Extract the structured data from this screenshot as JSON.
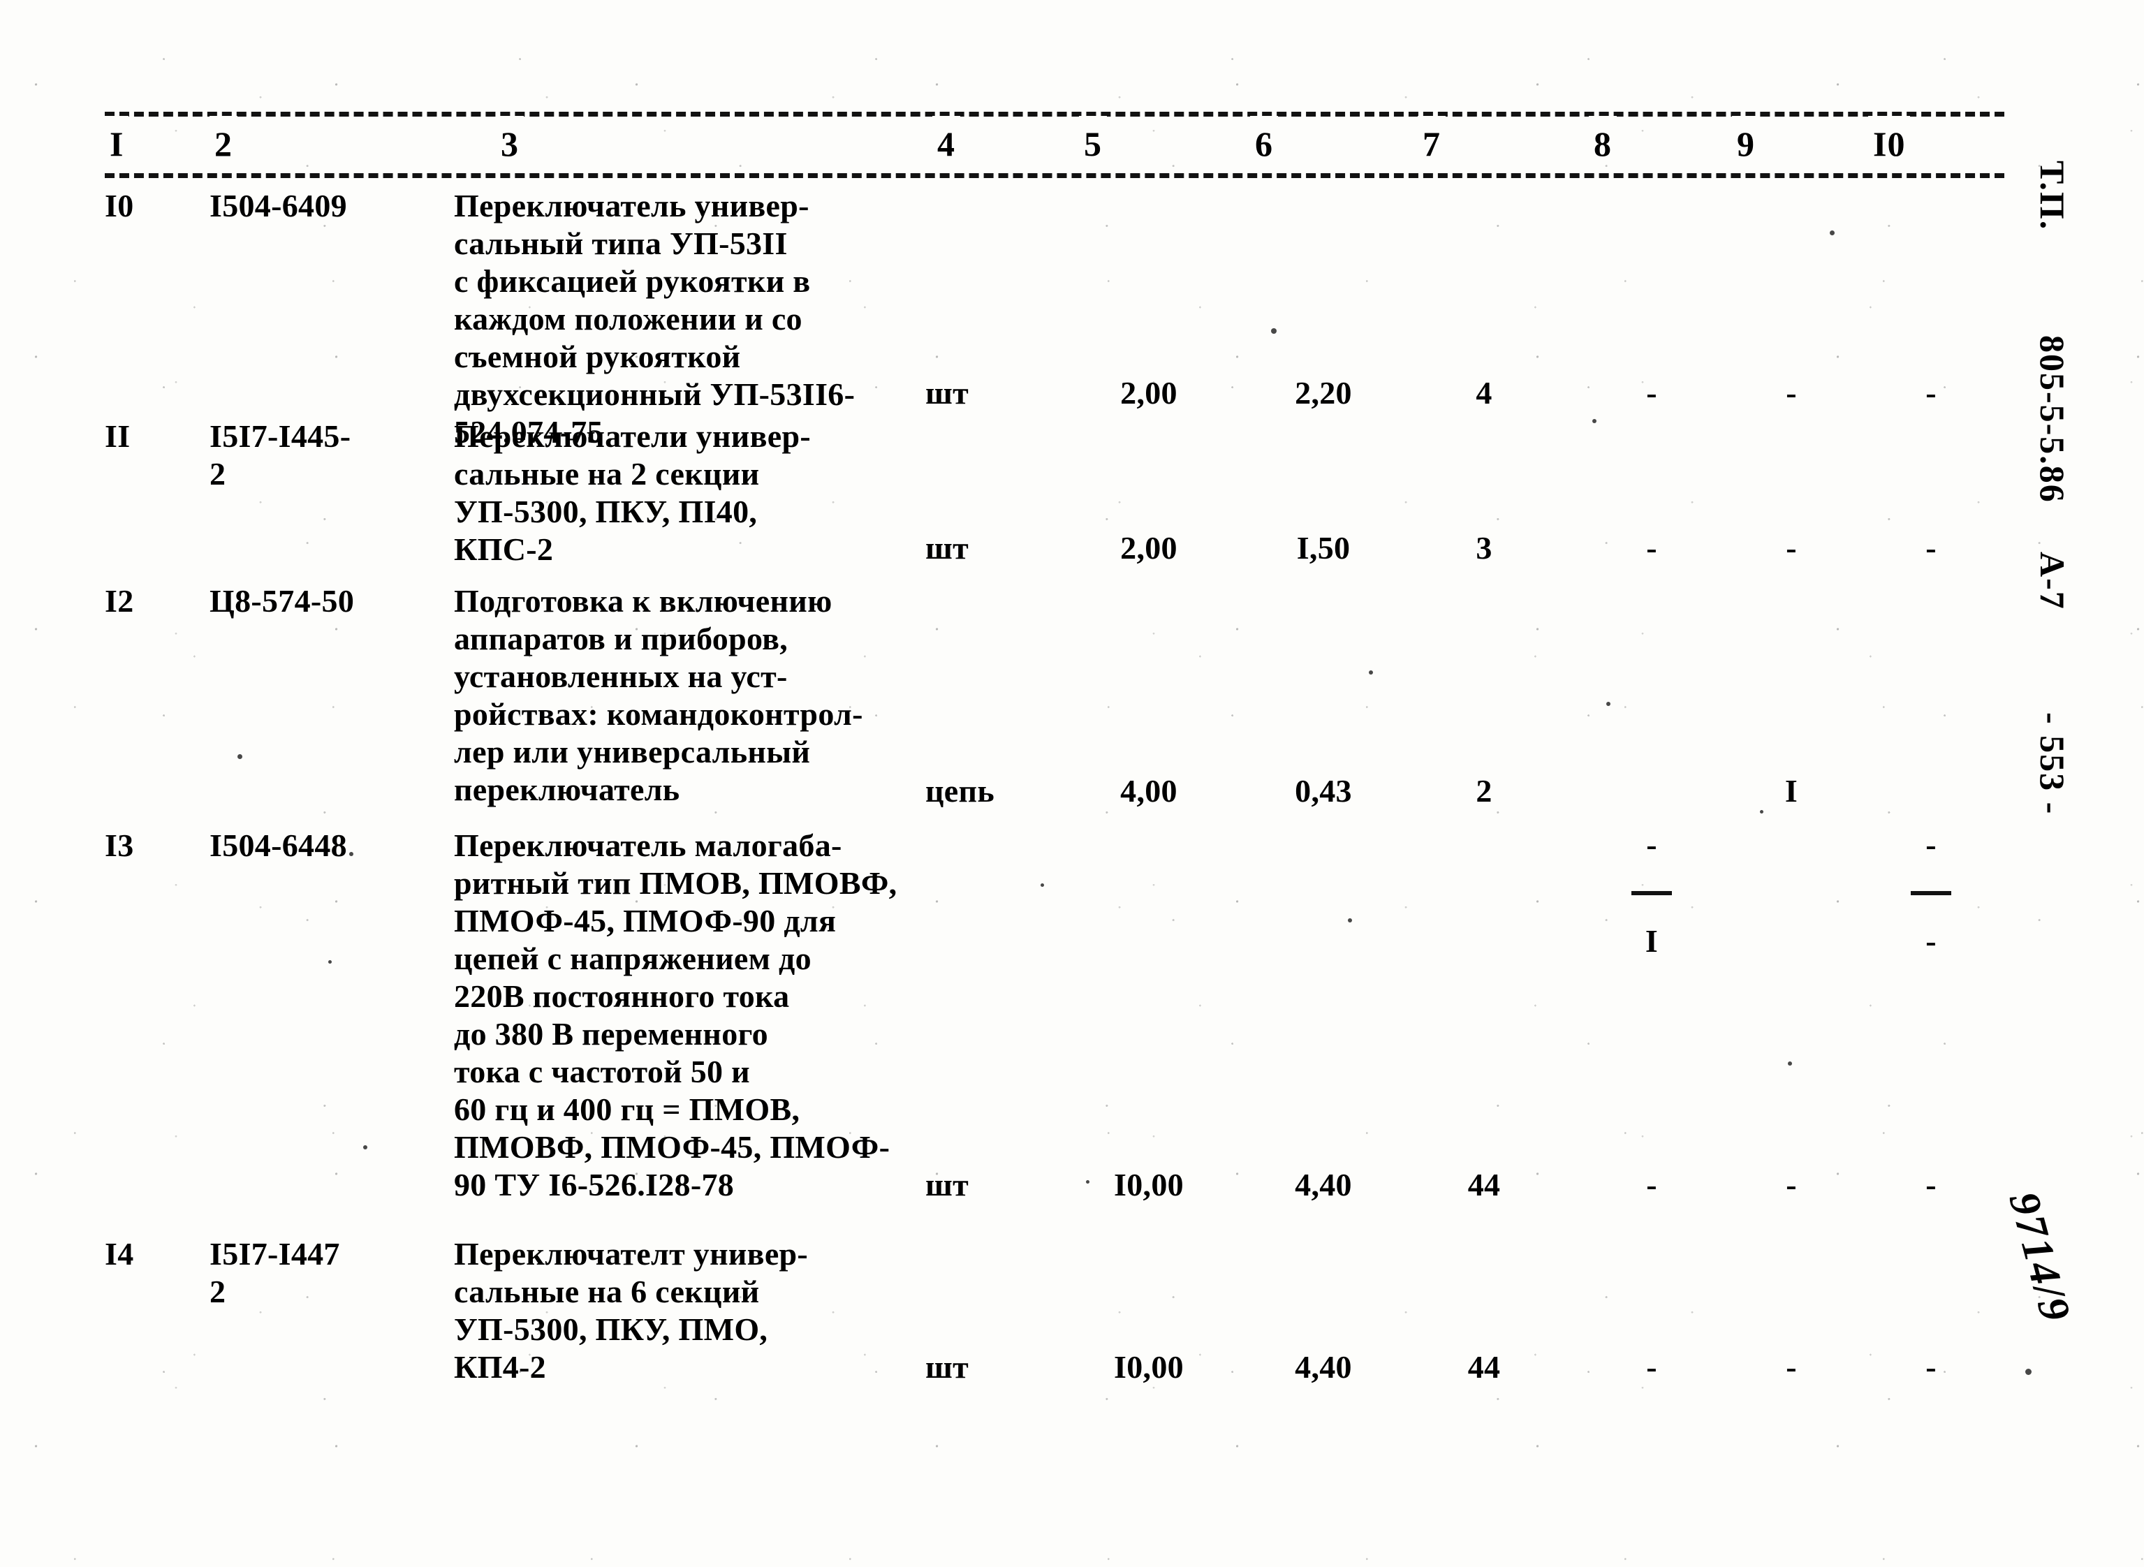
{
  "document": {
    "margin_labels": [
      "Т.П.",
      "805-5-5.86",
      "А-7",
      "- 553 -"
    ],
    "handwritten_note": "9714/9"
  },
  "table": {
    "column_headers": [
      "I",
      "2",
      "3",
      "4",
      "5",
      "6",
      "7",
      "8",
      "9",
      "I0"
    ],
    "rows": [
      {
        "no": "I0",
        "code": "I504-6409",
        "description": "Переключатель универ-\nсальный типа УП-53II\nс фиксацией рукоятки в\nкаждом положении и со\nсъемной рукояткой\nдвухсекционный УП-53II6-\n524.074-75",
        "unit": "шт",
        "v5": "2,00",
        "v6": "2,20",
        "v7": "4",
        "v8": "-",
        "v9": "-",
        "v10": "-"
      },
      {
        "no": "II",
        "code": "I5I7-I445-\n2",
        "description": "Переключатели универ-\nсальные на 2 секции\nУП-5300, ПКУ, ПI40,\nКПС-2",
        "unit": "шт",
        "v5": "2,00",
        "v6": "I,50",
        "v7": "3",
        "v8": "-",
        "v9": "-",
        "v10": "-"
      },
      {
        "no": "I2",
        "code": "Ц8-574-50",
        "description": "Подготовка к включению\nаппаратов и приборов,\nустановленных на уст-\nройствах: командоконтрол-\nлер или универсальный\nпереключатель",
        "unit": "цепь",
        "v5": "4,00",
        "v6": "0,43",
        "v7": "2",
        "v8": "-",
        "v8_den": "I",
        "v9": "I",
        "v10": "-",
        "v10_den": "-"
      },
      {
        "no": "I3",
        "code": "I504-6448",
        "description": "Переключатель малогаба-\nритный тип ПМОВ, ПМОВФ,\nПМОФ-45, ПМОФ-90 для\nцепей с напряжением до\n220В постоянного тока\nдо 380 В переменного\nтока с частотой 50 и\n60 гц и 400 гц = ПМОВ,\nПМОВФ, ПМОФ-45, ПМОФ-\n90 ТУ I6-526.I28-78",
        "unit": "шт",
        "v5": "I0,00",
        "v6": "4,40",
        "v7": "44",
        "v8": "-",
        "v9": "-",
        "v10": "-"
      },
      {
        "no": "I4",
        "code": "I5I7-I447\n2",
        "description": "Переключателт универ-\nсальные на 6 секций\nУП-5300, ПКУ, ПМО,\nКП4-2",
        "unit": "шт",
        "v5": "I0,00",
        "v6": "4,40",
        "v7": "44",
        "v8": "-",
        "v9": "-",
        "v10": "-"
      }
    ]
  }
}
